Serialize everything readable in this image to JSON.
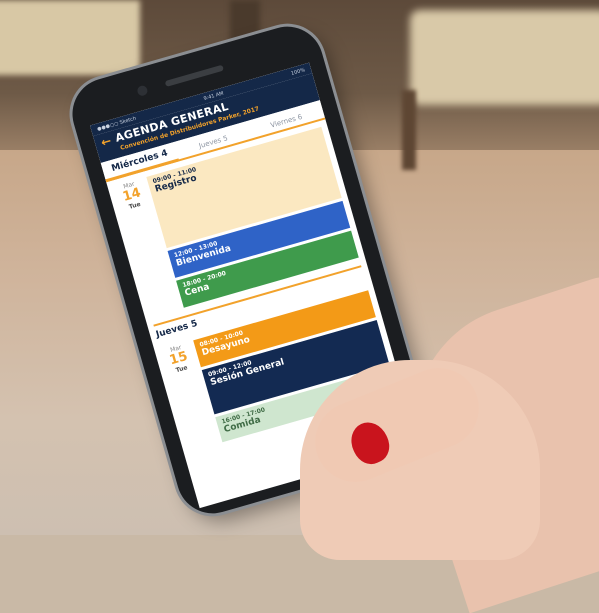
{
  "status_bar": {
    "carrier": "●●●○○ Sketch",
    "time": "9:41 AM",
    "battery": "100%"
  },
  "header": {
    "back_icon": "back-arrow-icon",
    "title": "AGENDA GENERAL",
    "subtitle": "Convención de Distribuidores Parker, 2017"
  },
  "tabs": [
    {
      "label": "Miércoles 4",
      "active": true
    },
    {
      "label": "Jueves 5",
      "active": false
    },
    {
      "label": "Viernes 6",
      "active": false
    }
  ],
  "days": [
    {
      "month": "Mar",
      "day_num": "14",
      "weekday": "Tue",
      "events": [
        {
          "time": "09:00 - 11:00",
          "title": "Registro",
          "color": "#fbe8c1"
        },
        {
          "time": "12:00 - 13:00",
          "title": "Bienvenida",
          "color": "#2f63c7"
        },
        {
          "time": "18:00 - 20:00",
          "title": "Cena",
          "color": "#3f9b4c"
        }
      ]
    },
    {
      "heading": "Jueves 5",
      "month": "Mar",
      "day_num": "15",
      "weekday": "Tue",
      "events": [
        {
          "time": "08:00 - 10:00",
          "title": "Desayuno",
          "color": "#f39a17"
        },
        {
          "time": "09:00 - 12:00",
          "title": "Sesión General",
          "color": "#132a52"
        },
        {
          "time": "16:00 - 17:00",
          "title": "Comida",
          "color": "#cfe6cf"
        }
      ]
    }
  ],
  "colors": {
    "brand_navy": "#142848",
    "accent_orange": "#f2a22b"
  }
}
